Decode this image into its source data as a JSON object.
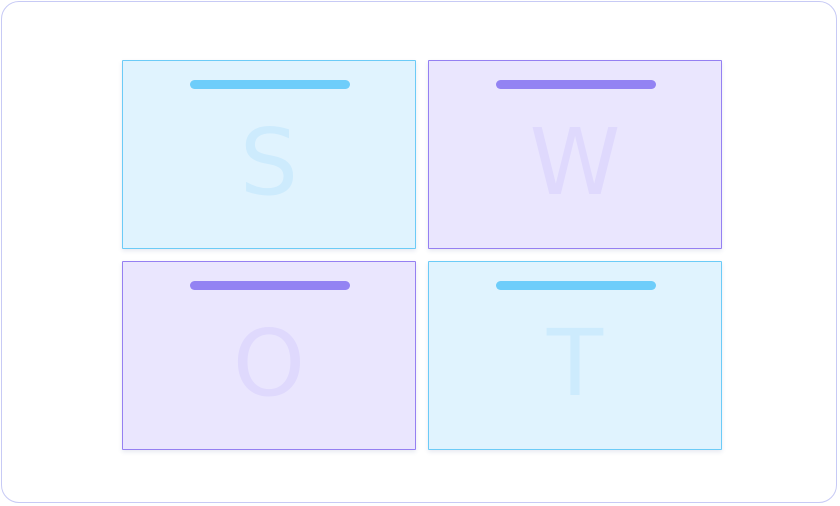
{
  "swot": {
    "quadrants": [
      {
        "letter": "S",
        "theme": "blue"
      },
      {
        "letter": "W",
        "theme": "purple"
      },
      {
        "letter": "O",
        "theme": "purple"
      },
      {
        "letter": "T",
        "theme": "blue"
      }
    ]
  },
  "colors": {
    "frame_border": "#C7CAF5",
    "blue_fill": "#E0F3FE",
    "blue_border": "#6CCBF7",
    "blue_bar": "#6ECDFA",
    "purple_fill": "#EAE6FE",
    "purple_border": "#9580F2",
    "purple_bar": "#9383F3"
  }
}
